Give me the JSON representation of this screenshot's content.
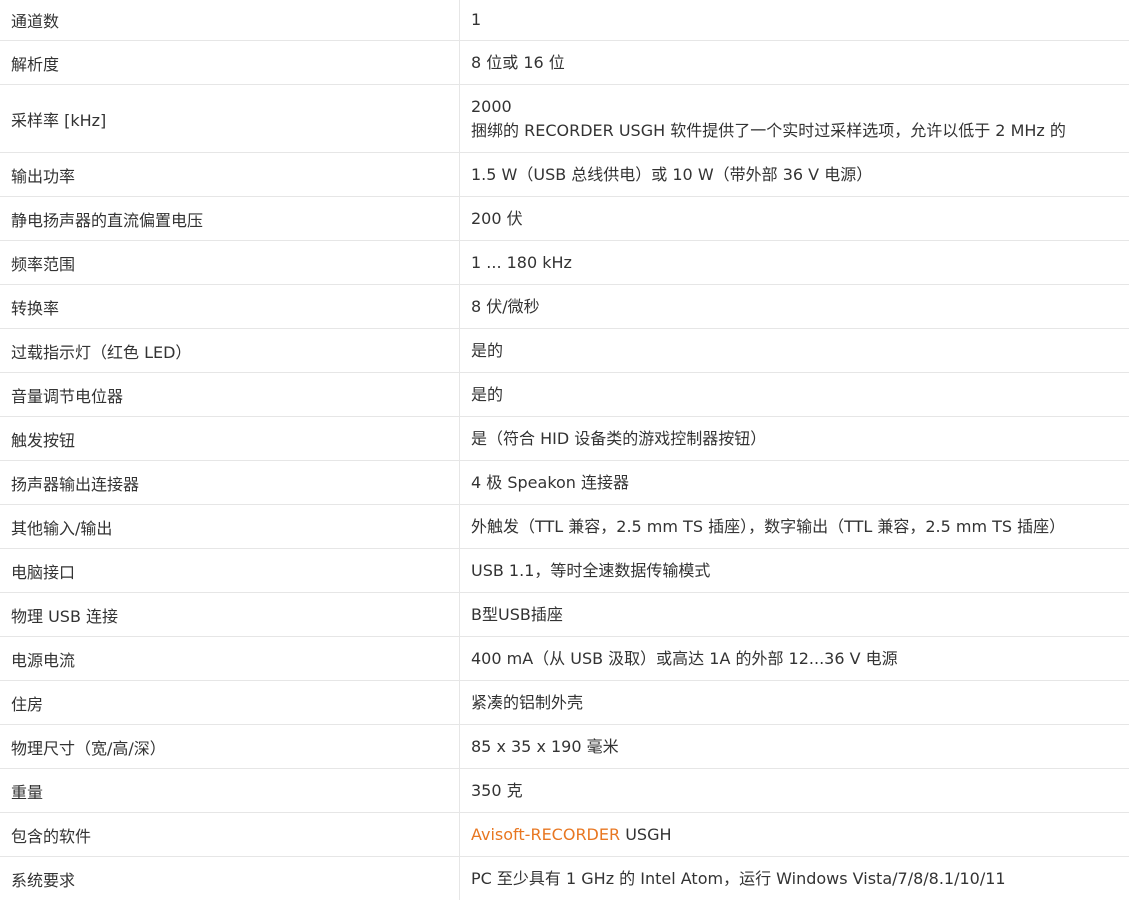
{
  "specs": [
    {
      "label": "通道数",
      "value": "1"
    },
    {
      "label": "解析度",
      "value": "8 位或 16 位"
    },
    {
      "label": "采样率 [kHz]",
      "value": "2000",
      "value2": "捆绑的 RECORDER USGH 软件提供了一个实时过采样选项，允许以低于 2 MHz 的"
    },
    {
      "label": "输出功率",
      "value": "1.5 W（USB 总线供电）或 10 W（带外部 36 V 电源）"
    },
    {
      "label": "静电扬声器的直流偏置电压",
      "value": "200 伏"
    },
    {
      "label": "频率范围",
      "value": "1 ... 180 kHz"
    },
    {
      "label": "转换率",
      "value": "8 伏/微秒"
    },
    {
      "label": "过载指示灯（红色 LED）",
      "value": "是的"
    },
    {
      "label": "音量调节电位器",
      "value": "是的"
    },
    {
      "label": "触发按钮",
      "value": "是（符合 HID 设备类的游戏控制器按钮）"
    },
    {
      "label": "扬声器输出连接器",
      "value": "4 极 Speakon 连接器"
    },
    {
      "label": "其他输入/输出",
      "value": "外触发（TTL 兼容，2.5 mm TS 插座），数字输出（TTL 兼容，2.5 mm TS 插座）"
    },
    {
      "label": "电脑接口",
      "value": "USB 1.1，等时全速数据传输模式"
    },
    {
      "label": "物理 USB 连接",
      "value": "B型USB插座"
    },
    {
      "label": "电源电流",
      "value": "400 mA（从 USB 汲取）或高达 1A 的外部 12...36 V 电源"
    },
    {
      "label": "住房",
      "value": "紧凑的铝制外壳"
    },
    {
      "label": "物理尺寸（宽/高/深）",
      "value": "85 x 35 x 190 毫米"
    },
    {
      "label": "重量",
      "value": "350 克"
    },
    {
      "label": "包含的软件",
      "link": "Avisoft-RECORDER",
      "value": " USGH"
    },
    {
      "label": "系统要求",
      "value": "PC 至少具有 1 GHz 的 Intel Atom，运行 Windows Vista/7/8/8.1/10/11"
    }
  ],
  "colors": {
    "link": "#e87722",
    "border": "#e6e6e6",
    "text": "#333333"
  }
}
